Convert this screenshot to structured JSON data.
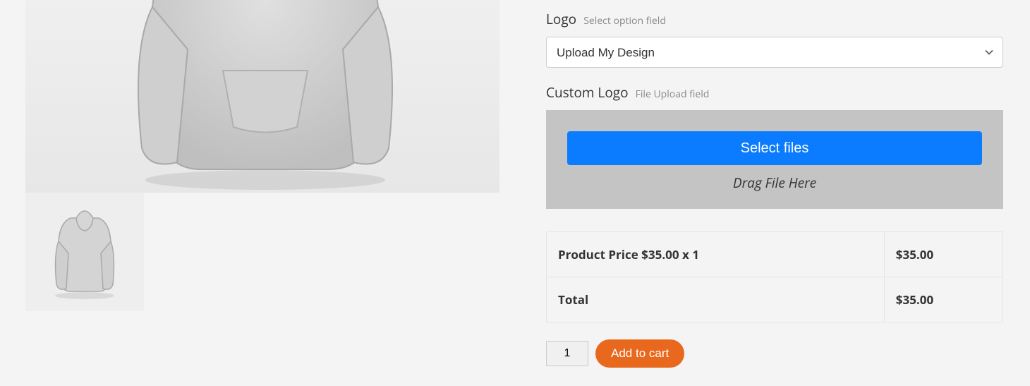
{
  "logo_field": {
    "label": "Logo",
    "hint": "Select option field",
    "selected": "Upload My Design"
  },
  "custom_logo_field": {
    "label": "Custom Logo",
    "hint": "File Upload field",
    "button": "Select files",
    "drag_hint": "Drag File Here"
  },
  "price_table": {
    "product_price_label": "Product Price $35.00 x 1",
    "product_price_value": "$35.00",
    "total_label": "Total",
    "total_value": "$35.00"
  },
  "cart": {
    "quantity": "1",
    "add_label": "Add to cart"
  }
}
